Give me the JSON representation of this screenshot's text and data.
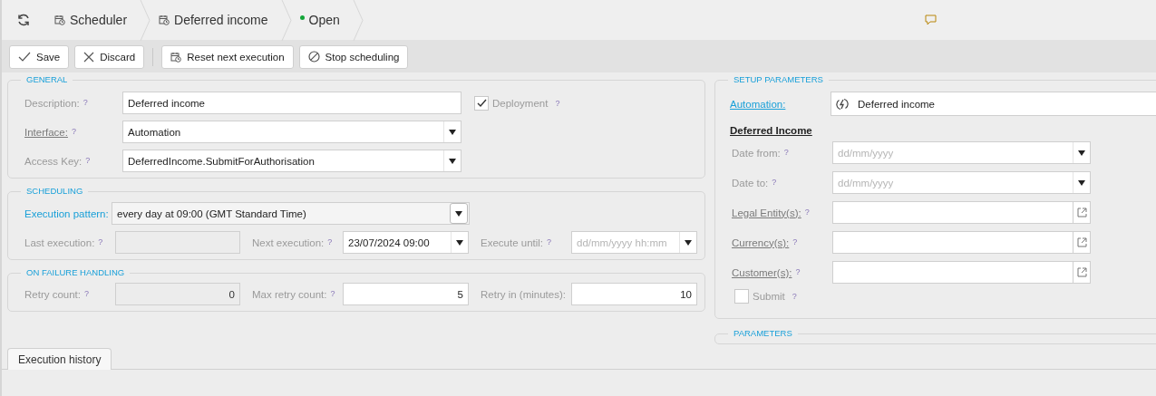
{
  "breadcrumbs": [
    {
      "kind": "page",
      "label": "Scheduler"
    },
    {
      "kind": "page",
      "label": "Deferred income"
    },
    {
      "kind": "status",
      "label": "Open",
      "color": "#13a538"
    }
  ],
  "toolbar": [
    {
      "kind": "save",
      "label": "Save",
      "separator_before": false
    },
    {
      "kind": "discard",
      "label": "Discard",
      "separator_before": false
    },
    {
      "kind": "reset",
      "label": "Reset next execution",
      "separator_before": true
    },
    {
      "kind": "stop",
      "label": "Stop scheduling",
      "separator_before": false
    }
  ],
  "general": {
    "title": "GENERAL",
    "fields": [
      {
        "kind": "text",
        "label": "Description:",
        "link": false,
        "hint": "?",
        "value": "Deferred income"
      },
      {
        "kind": "select",
        "label": "Interface:",
        "link": true,
        "hint": "?",
        "value": "Automation"
      },
      {
        "kind": "select",
        "label": "Access Key:",
        "link": false,
        "hint": "?",
        "value": "DeferredIncome.SubmitForAuthorisation"
      }
    ],
    "deployment": {
      "label": "Deployment",
      "checked": true,
      "hint": "?"
    }
  },
  "scheduling": {
    "title": "SCHEDULING",
    "pattern": {
      "label": "Execution pattern:",
      "value": "every day at 09:00 (GMT Standard Time)"
    },
    "fields": [
      {
        "kind": "readonly",
        "label": "Last execution:",
        "hint": "?"
      },
      {
        "kind": "select",
        "label": "Next execution:",
        "hint": "?",
        "value": "23/07/2024 09:00"
      },
      {
        "kind": "select",
        "label": "Execute until:",
        "hint": "?",
        "placeholder": "dd/mm/yyyy hh:mm"
      }
    ]
  },
  "failure": {
    "title": "ON FAILURE HANDLING",
    "fields": [
      {
        "kind": "readonly",
        "label": "Retry count:",
        "hint": "?",
        "value": "0"
      },
      {
        "kind": "number",
        "label": "Max retry count:",
        "hint": "?",
        "value": "5"
      },
      {
        "kind": "number",
        "label": "Retry in (minutes):",
        "value": "10"
      }
    ]
  },
  "setup": {
    "title": "SETUP PARAMETERS",
    "automation": {
      "label": "Automation:",
      "value": "Deferred income"
    },
    "heading": "Deferred Income",
    "fields": [
      {
        "kind": "select",
        "label": "Date from:",
        "link": false,
        "hint": "?",
        "placeholder": "dd/mm/yyyy"
      },
      {
        "kind": "select",
        "label": "Date to:",
        "link": false,
        "hint": "?",
        "placeholder": "dd/mm/yyyy"
      },
      {
        "kind": "lookup",
        "label": "Legal Entity(s):",
        "link": true,
        "hint": "?"
      },
      {
        "kind": "lookup",
        "label": "Currency(s):",
        "link": true,
        "hint": "?"
      },
      {
        "kind": "lookup",
        "label": "Customer(s):",
        "link": true,
        "hint": "?"
      }
    ],
    "submit": {
      "label": "Submit",
      "checked": false,
      "hint": "?"
    }
  },
  "parameters": {
    "title": "PARAMETERS"
  },
  "tabs": [
    {
      "label": "Execution history",
      "selected": true
    }
  ]
}
